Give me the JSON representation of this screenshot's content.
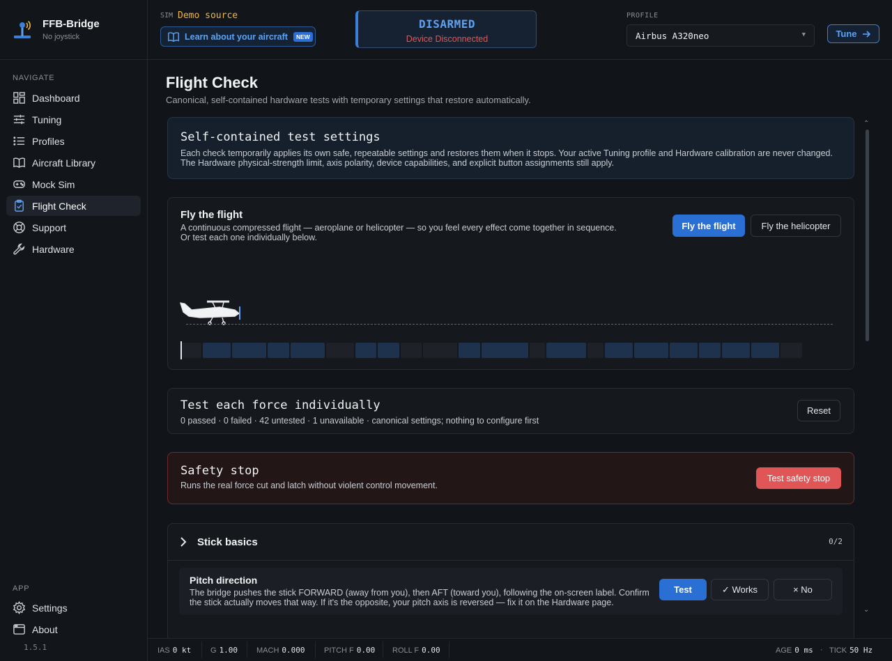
{
  "brand": {
    "title": "FFB-Bridge",
    "subtitle": "No joystick"
  },
  "sidebar": {
    "navigate_label": "NAVIGATE",
    "items": [
      {
        "label": "Dashboard",
        "icon": "dashboard-icon"
      },
      {
        "label": "Tuning",
        "icon": "sliders-icon"
      },
      {
        "label": "Profiles",
        "icon": "list-icon"
      },
      {
        "label": "Aircraft Library",
        "icon": "book-icon"
      },
      {
        "label": "Mock Sim",
        "icon": "gamepad-icon"
      },
      {
        "label": "Flight Check",
        "icon": "clipboard-check-icon",
        "active": true
      },
      {
        "label": "Support",
        "icon": "lifebuoy-icon"
      },
      {
        "label": "Hardware",
        "icon": "wrench-icon"
      }
    ],
    "app_label": "APP",
    "app_items": [
      {
        "label": "Settings",
        "icon": "gear-icon"
      },
      {
        "label": "About",
        "icon": "window-icon"
      }
    ],
    "version": "1.5.1"
  },
  "topbar": {
    "sim_label": "SIM",
    "sim_source": "Demo source",
    "learn_label": "Learn about your aircraft",
    "new_badge": "NEW",
    "status_main": "DISARMED",
    "status_sub": "Device Disconnected",
    "profile_label": "PROFILE",
    "profile_value": "Airbus A320neo",
    "tune_label": "Tune"
  },
  "page": {
    "title": "Flight Check",
    "subtitle": "Canonical, self-contained hardware tests with temporary settings that restore automatically."
  },
  "settings_card": {
    "title": "Self-contained test settings",
    "body": "Each check temporarily applies its own safe, repeatable settings and restores them when it stops. Your active Tuning profile and Hardware calibration are never changed. The Hardware physical-strength limit, axis polarity, device capabilities, and explicit button assignments still apply."
  },
  "flight_card": {
    "title": "Fly the flight",
    "line1": "A continuous compressed flight — aeroplane or helicopter — so you feel every effect come together in sequence.",
    "line2": "Or test each one individually below.",
    "fly_flight_label": "Fly the flight",
    "fly_heli_label": "Fly the helicopter",
    "timeline_segments": [
      {
        "w": 30,
        "lit": false
      },
      {
        "w": 42,
        "lit": true
      },
      {
        "w": 51,
        "lit": true
      },
      {
        "w": 33,
        "lit": true
      },
      {
        "w": 51,
        "lit": true
      },
      {
        "w": 42,
        "lit": false
      },
      {
        "w": 32,
        "lit": true
      },
      {
        "w": 33,
        "lit": true
      },
      {
        "w": 32,
        "lit": false
      },
      {
        "w": 51,
        "lit": false
      },
      {
        "w": 33,
        "lit": true
      },
      {
        "w": 69,
        "lit": true
      },
      {
        "w": 24,
        "lit": false
      },
      {
        "w": 59,
        "lit": true
      },
      {
        "w": 25,
        "lit": false
      },
      {
        "w": 42,
        "lit": true
      },
      {
        "w": 51,
        "lit": true
      },
      {
        "w": 42,
        "lit": true
      },
      {
        "w": 33,
        "lit": true
      },
      {
        "w": 42,
        "lit": true
      },
      {
        "w": 42,
        "lit": true
      },
      {
        "w": 33,
        "lit": false
      }
    ]
  },
  "force_card": {
    "title": "Test each force individually",
    "summary": "0 passed · 0 failed · 42 untested · 1 unavailable · canonical settings; nothing to configure first",
    "reset_label": "Reset"
  },
  "safety_card": {
    "title": "Safety stop",
    "body": "Runs the real force cut and latch without violent control movement.",
    "button_label": "Test safety stop"
  },
  "group": {
    "title": "Stick basics",
    "count": "0/2",
    "test": {
      "title": "Pitch direction",
      "body": "The bridge pushes the stick FORWARD (away from you), then AFT (toward you), following the on-screen label. Confirm the stick actually moves that way. If it's the opposite, your pitch axis is reversed — fix it on the Hardware page.",
      "test_label": "Test",
      "works_label": "✓ Works",
      "no_label": "× No"
    }
  },
  "statusbar": {
    "ias_label": "IAS",
    "ias_value": "0 kt",
    "g_label": "G",
    "g_value": "1.00",
    "mach_label": "MACH",
    "mach_value": "0.000",
    "pitchf_label": "PITCH F",
    "pitchf_value": "0.00",
    "rollf_label": "ROLL F",
    "rollf_value": "0.00",
    "age_label": "AGE",
    "age_value": "0 ms",
    "dot": "·",
    "tick_label": "TICK",
    "tick_value": "50 Hz"
  },
  "colors": {
    "accent": "#2a6fd4",
    "warning": "#e05656",
    "sim": "#f2b740"
  }
}
